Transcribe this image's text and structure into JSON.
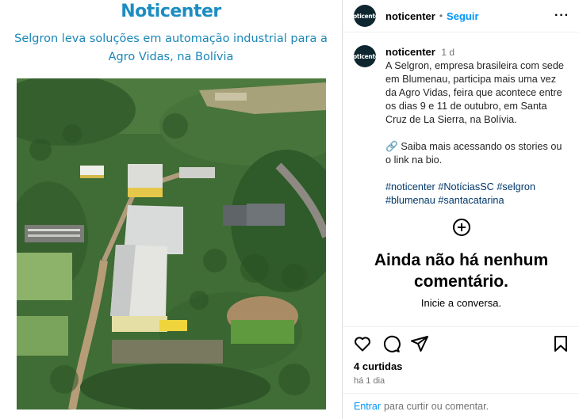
{
  "post": {
    "brand_prefix": "N",
    "brand_rest": "oticenter",
    "headline": "Selgron leva soluções em automação industrial para a Agro Vidas, na Bolívia"
  },
  "header": {
    "avatar_text": "Noticenter",
    "username": "noticenter",
    "separator": "•",
    "follow_label": "Seguir",
    "more_label": "···"
  },
  "caption": {
    "username": "noticenter",
    "time": "1 d",
    "text": "A Selgron, empresa brasileira com sede em Blumenau, participa mais uma vez da Agro Vidas, feira que acontece entre os dias 9 e 11 de outubro, em Santa Cruz de La Sierra, na Bolívia.",
    "link_line": "🔗 Saiba mais acessando os stories ou o link na bio.",
    "hashtags": [
      "#noticenter",
      "#NotíciasSC",
      "#selgron",
      "#blumenau",
      "#santacatarina"
    ]
  },
  "comments": {
    "empty_title": "Ainda não há nenhum comentário.",
    "empty_sub": "Inicie a conversa."
  },
  "actions": {
    "icons": [
      "heart-icon",
      "comment-icon",
      "share-icon",
      "bookmark-icon"
    ],
    "likes": "4 curtidas",
    "ago": "há 1 dia"
  },
  "login": {
    "link": "Entrar",
    "rest": "para curtir ou comentar."
  },
  "colors": {
    "brand": "#1c8dc1",
    "follow": "#0095f6",
    "hashtag": "#00376b"
  }
}
